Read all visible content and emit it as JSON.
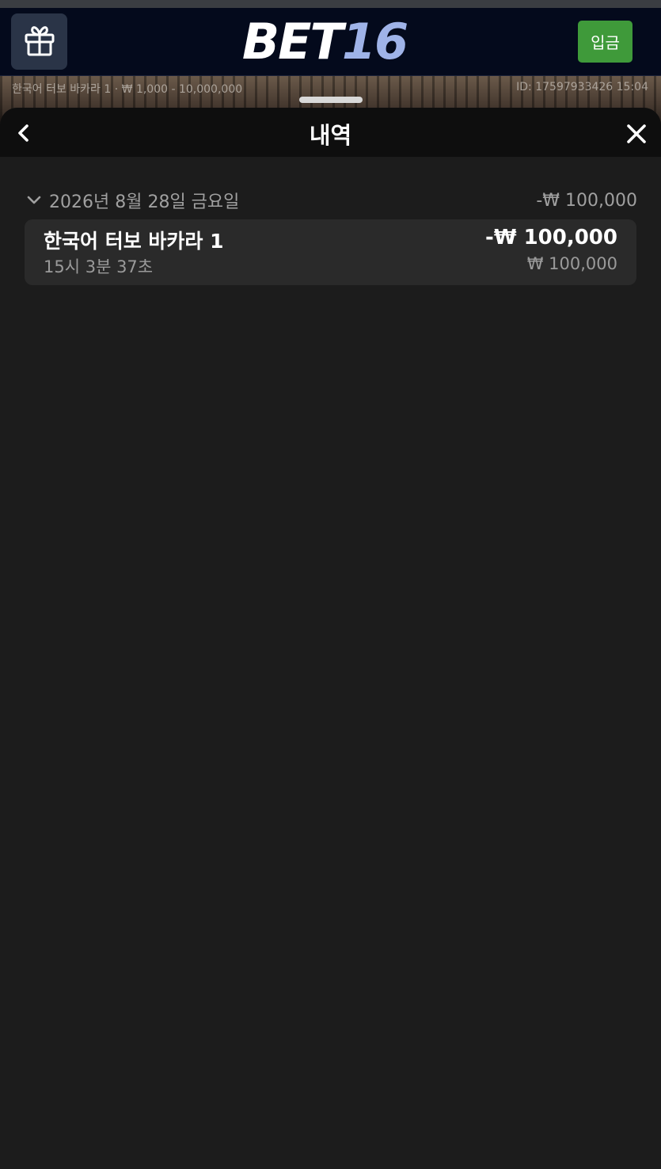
{
  "header": {
    "logo_main": "BET",
    "logo_number": "16",
    "deposit_label": "입금",
    "icons": {
      "gift": "gift-icon"
    },
    "colors": {
      "bar_bg": "#040a1c",
      "deposit_bg": "#3f9a3a",
      "logo_accent": "#9fb3e8"
    }
  },
  "game_info": {
    "table_limits": "한국어 터보 바카라 1 · ₩ 1,000 - 10,000,000",
    "round_id": "ID: 17597933426 15:04"
  },
  "sheet": {
    "title": "내역",
    "icons": {
      "back": "chevron-left-icon",
      "close": "close-icon"
    }
  },
  "history": {
    "groups": [
      {
        "date": "2026년 8월 28일 금요일",
        "total": "-₩ 100,000",
        "expanded": true,
        "entries": [
          {
            "game": "한국어 터보 바카라 1",
            "time": "15시 3분 37초",
            "result": "-₩ 100,000",
            "stake": "₩ 100,000"
          }
        ]
      }
    ]
  }
}
